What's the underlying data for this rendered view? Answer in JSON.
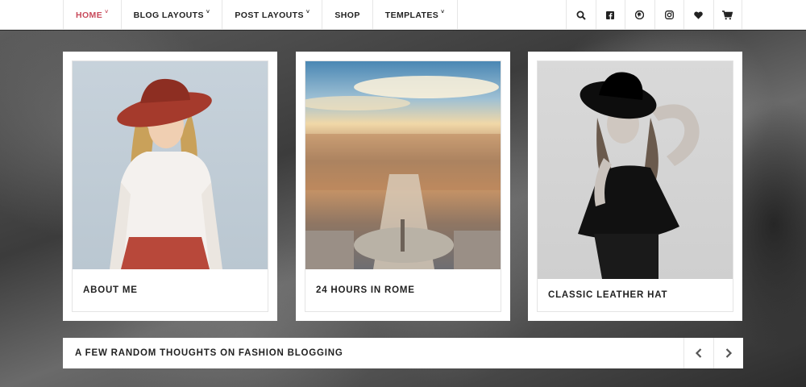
{
  "nav": {
    "items": [
      {
        "label": "HOME",
        "has_caret": true,
        "active": true
      },
      {
        "label": "BLOG LAYOUTS",
        "has_caret": true,
        "active": false
      },
      {
        "label": "POST LAYOUTS",
        "has_caret": true,
        "active": false
      },
      {
        "label": "SHOP",
        "has_caret": false,
        "active": false
      },
      {
        "label": "TEMPLATES",
        "has_caret": true,
        "active": false
      }
    ],
    "caret_glyph": "˅",
    "icons": [
      "search-icon",
      "facebook-icon",
      "pinterest-icon",
      "instagram-icon",
      "heart-icon",
      "cart-icon"
    ]
  },
  "colors": {
    "accent": "#c84a5b",
    "text": "#222222",
    "border": "#e6e6e6"
  },
  "cards": [
    {
      "title": "ABOUT ME",
      "image": "woman-in-red-hat-photo"
    },
    {
      "title": "24 HOURS IN ROME",
      "image": "rome-aerial-view-photo"
    },
    {
      "title": "CLASSIC LEATHER HAT",
      "image": "woman-in-black-hat-photo"
    }
  ],
  "ticker": {
    "text": "A FEW RANDOM THOUGHTS ON FASHION BLOGGING",
    "prev_icon": "chevron-left-icon",
    "next_icon": "chevron-right-icon"
  }
}
